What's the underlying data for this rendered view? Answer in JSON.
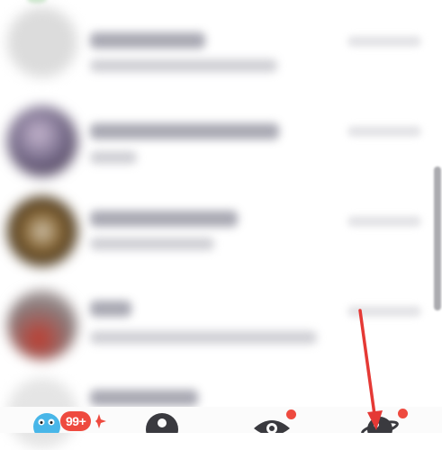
{
  "accent_color": "#ee4a3f",
  "conversations": [
    {
      "avatar_color": "#dcdcdc"
    },
    {
      "avatar_color": "#7a6f8d"
    },
    {
      "avatar_color": "#3b2a14"
    },
    {
      "avatar_color": "#8a7c7c"
    },
    {
      "avatar_color": "#e5e5e5"
    }
  ],
  "tabbar": {
    "tabs": [
      {
        "icon": "smile-face-icon",
        "badge": "99+"
      },
      {
        "icon": "person-icon"
      },
      {
        "icon": "eye-icon",
        "has_dot": true
      },
      {
        "icon": "planet-icon",
        "has_dot": true
      }
    ]
  },
  "annotation": {
    "icon": "red-arrow-icon",
    "color": "#e53935"
  }
}
